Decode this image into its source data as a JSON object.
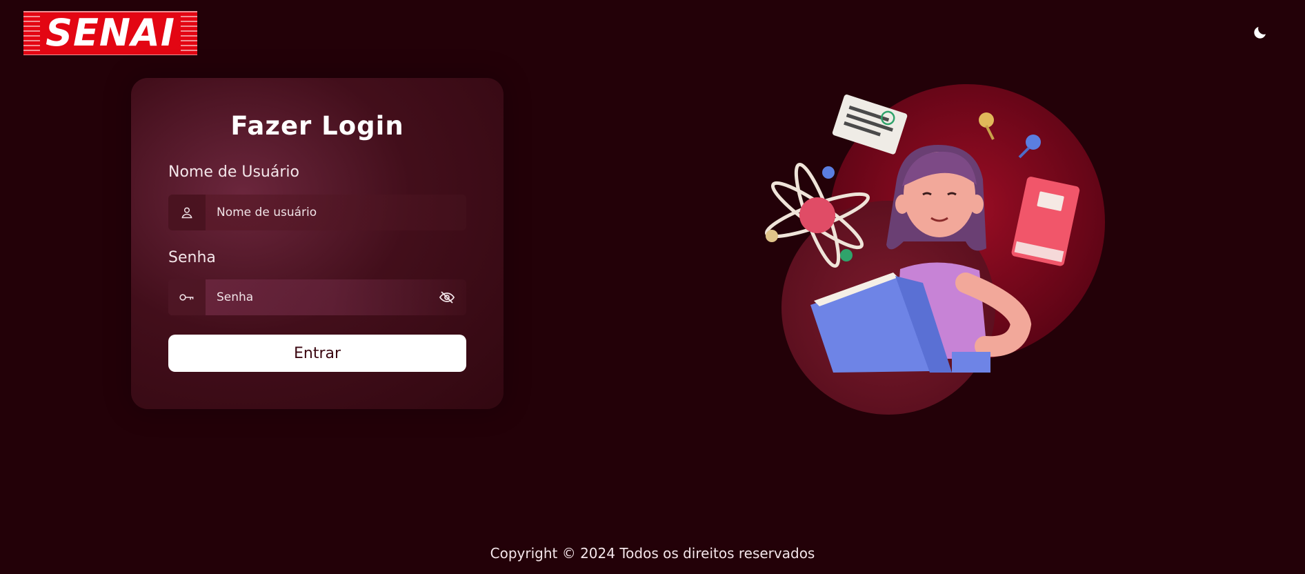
{
  "brand": {
    "logo_text": "SENAI",
    "logo_color": "#e30613"
  },
  "theme_toggle": {
    "icon": "moon-icon"
  },
  "login": {
    "title": "Fazer Login",
    "username": {
      "label": "Nome de Usuário",
      "placeholder": "Nome de usuário",
      "value": "",
      "icon": "user-icon"
    },
    "password": {
      "label": "Senha",
      "placeholder": "Senha",
      "value": "",
      "icon": "key-icon",
      "toggle_icon": "eye-off-icon"
    },
    "submit_label": "Entrar"
  },
  "illustration": {
    "subject": "student-reading-illustration"
  },
  "footer": {
    "copyright": "Copyright © 2024 Todos os direitos reservados"
  },
  "colors": {
    "background": "#230108",
    "button_bg": "#ffffff",
    "button_text": "#3a0610"
  }
}
